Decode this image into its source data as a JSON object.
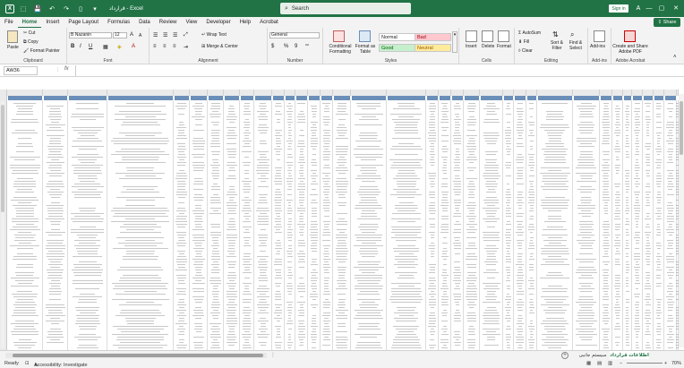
{
  "titlebar": {
    "app_icon": "X",
    "file_title": "قرارداد - Excel",
    "search_placeholder": "Search",
    "signin_label": "Sign in",
    "account_initial": "A"
  },
  "menubar": {
    "items": [
      "File",
      "Home",
      "Insert",
      "Page Layout",
      "Formulas",
      "Data",
      "Review",
      "View",
      "Developer",
      "Help",
      "Acrobat"
    ],
    "active": "Home",
    "share_label": "Share"
  },
  "ribbon": {
    "clipboard": {
      "paste": "Paste",
      "cut": "Cut",
      "copy": "Copy",
      "format_painter": "Format Painter",
      "label": "Clipboard"
    },
    "font": {
      "font_name": "B Nazanin",
      "font_size": "12",
      "bold": "B",
      "italic": "I",
      "underline": "U",
      "grow": "A",
      "shrink": "A",
      "label": "Font"
    },
    "alignment": {
      "wrap_text": "Wrap Text",
      "merge_center": "Merge & Center",
      "label": "Alignment"
    },
    "number": {
      "format": "General",
      "currency": "$",
      "percent": "%",
      "comma": "9",
      "label": "Number"
    },
    "styles": {
      "conditional": "Conditional Formatting",
      "format_table": "Format as Table",
      "cells": [
        {
          "label": "Normal",
          "bg": "#ffffff",
          "fg": "#222222"
        },
        {
          "label": "Bad",
          "bg": "#ffc7ce",
          "fg": "#9c0006"
        },
        {
          "label": "Good",
          "bg": "#c6efce",
          "fg": "#006100"
        },
        {
          "label": "Neutral",
          "bg": "#ffeb9c",
          "fg": "#9c5700"
        }
      ],
      "label": "Styles"
    },
    "cells": {
      "insert": "Insert",
      "delete": "Delete",
      "format": "Format",
      "label": "Cells"
    },
    "editing": {
      "autosum": "AutoSum",
      "fill": "Fill",
      "clear": "Clear",
      "sort_filter": "Sort & Filter",
      "find_select": "Find & Select",
      "label": "Editing"
    },
    "addins": {
      "addins": "Add-ins",
      "label": "Add-ins"
    },
    "acrobat": {
      "create_share": "Create and Share Adobe PDF",
      "label": "Adobe Acrobat"
    }
  },
  "formula_bar": {
    "name_box": "AW36",
    "fx": "fx",
    "content": ""
  },
  "sheet_tabs": {
    "tabs": [
      "اطلاعات قرارداد",
      "سیستم جانبی"
    ],
    "active": "اطلاعات قرارداد"
  },
  "status": {
    "ready": "Ready",
    "accessibility": "Accessibility: Investigate",
    "zoom": "70%"
  },
  "colors": {
    "accent": "#217346",
    "header_band": "#6b8fb8"
  }
}
